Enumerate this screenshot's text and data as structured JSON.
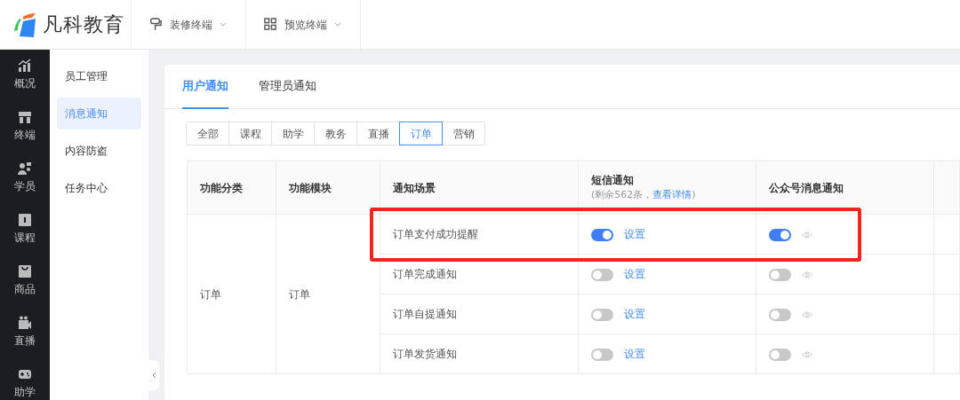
{
  "logo": {
    "text": "凡科教育"
  },
  "top_menu": [
    {
      "label": "装修终端"
    },
    {
      "label": "预览终端"
    }
  ],
  "rail": [
    {
      "label": "概况"
    },
    {
      "label": "终端"
    },
    {
      "label": "学员"
    },
    {
      "label": "课程"
    },
    {
      "label": "商品"
    },
    {
      "label": "直播"
    },
    {
      "label": "助学"
    }
  ],
  "submenu": [
    {
      "label": "员工管理",
      "selected": false
    },
    {
      "label": "消息通知",
      "selected": true
    },
    {
      "label": "内容防盗",
      "selected": false
    },
    {
      "label": "任务中心",
      "selected": false
    }
  ],
  "tabs": [
    {
      "label": "用户通知",
      "selected": true
    },
    {
      "label": "管理员通知",
      "selected": false
    }
  ],
  "filters": [
    {
      "label": "全部",
      "selected": false
    },
    {
      "label": "课程",
      "selected": false
    },
    {
      "label": "助学",
      "selected": false
    },
    {
      "label": "教务",
      "selected": false
    },
    {
      "label": "直播",
      "selected": false
    },
    {
      "label": "订单",
      "selected": true
    },
    {
      "label": "营销",
      "selected": false
    }
  ],
  "table": {
    "columns": [
      {
        "label": "功能分类"
      },
      {
        "label": "功能模块"
      },
      {
        "label": "通知场景"
      },
      {
        "label": "短信通知",
        "note": "(剩余562条，",
        "note_link": "查看详情",
        "note_end": ")"
      },
      {
        "label": "公众号消息通知"
      }
    ],
    "category": "订单",
    "module": "订单",
    "rows": [
      {
        "scene": "订单支付成功提醒",
        "sms_on": true,
        "sms_action": "设置",
        "wechat_on": true,
        "highlighted": true
      },
      {
        "scene": "订单完成通知",
        "sms_on": false,
        "sms_action": "设置",
        "wechat_on": false,
        "highlighted": false
      },
      {
        "scene": "订单自提通知",
        "sms_on": false,
        "sms_action": "设置",
        "wechat_on": false,
        "highlighted": false
      },
      {
        "scene": "订单发货通知",
        "sms_on": false,
        "sms_action": "设置",
        "wechat_on": false,
        "highlighted": false
      }
    ]
  }
}
